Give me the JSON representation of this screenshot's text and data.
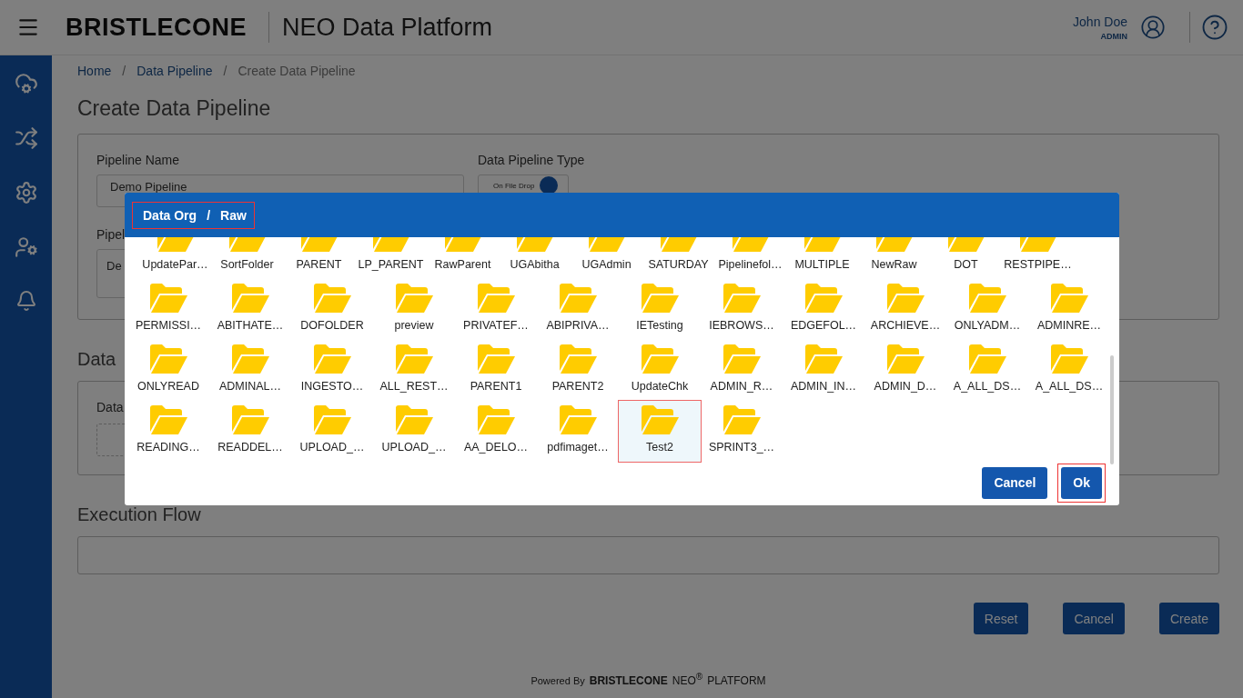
{
  "header": {
    "logo": "BRISTLECONE",
    "app_title": "NEO Data Platform",
    "user_name": "John Doe",
    "user_role": "ADMIN"
  },
  "breadcrumb_separator": "/",
  "breadcrumb": [
    {
      "label": "Home",
      "link": true
    },
    {
      "label": "Data Pipeline",
      "link": true
    },
    {
      "label": "Create Data Pipeline",
      "link": false
    }
  ],
  "page_title": "Create Data Pipeline",
  "form": {
    "pipeline_name_label": "Pipeline Name",
    "pipeline_name_value": "Demo Pipeline",
    "type_label": "Data Pipeline Type",
    "type_toggle": {
      "label": "On File Drop",
      "on": true
    },
    "description_label": "Pipel",
    "description_value": "De"
  },
  "data_section": {
    "title": "Data",
    "field_label": "Data"
  },
  "execution_flow": {
    "title": "Execution Flow"
  },
  "actions": [
    "Reset",
    "Cancel",
    "Create"
  ],
  "footer": {
    "powered_by": "Powered By",
    "brand": "BRISTLECONE",
    "product": "NEO$^{®}$",
    "suffix": "PLATFORM"
  },
  "dialog": {
    "path_separator": "/",
    "path": [
      {
        "label": "Data Org"
      },
      {
        "label": "Raw"
      }
    ],
    "folder_rows": [
      [
        {
          "name": "UpdatePar…",
          "selected": false
        },
        {
          "name": "SortFolder",
          "selected": false
        },
        {
          "name": "PARENT",
          "selected": false
        },
        {
          "name": "LP_PARENT",
          "selected": false
        },
        {
          "name": "RawParent",
          "selected": false
        },
        {
          "name": "UGAbitha",
          "selected": false
        },
        {
          "name": "UGAdmin",
          "selected": false
        },
        {
          "name": "SATURDAY",
          "selected": false
        },
        {
          "name": "Pipelinefol…",
          "selected": false
        },
        {
          "name": "MULTIPLE",
          "selected": false
        },
        {
          "name": "NewRaw",
          "selected": false
        },
        {
          "name": "DOT",
          "selected": false
        },
        {
          "name": "RESTPIPE…",
          "selected": false
        }
      ],
      [
        {
          "name": "PERMISSI…",
          "selected": false
        },
        {
          "name": "ABITHATE…",
          "selected": false
        },
        {
          "name": "DOFOLDER",
          "selected": false
        },
        {
          "name": "preview",
          "selected": false
        },
        {
          "name": "PRIVATEF…",
          "selected": false
        },
        {
          "name": "ABIPRIVA…",
          "selected": false
        },
        {
          "name": "IETesting",
          "selected": false
        },
        {
          "name": "IEBROWS…",
          "selected": false
        },
        {
          "name": "EDGEFOL…",
          "selected": false
        },
        {
          "name": "ARCHIEVE…",
          "selected": false
        },
        {
          "name": "ONLYADM…",
          "selected": false
        },
        {
          "name": "ADMINRE…",
          "selected": false
        }
      ],
      [
        {
          "name": "ONLYREAD",
          "selected": false
        },
        {
          "name": "ADMINAL…",
          "selected": false
        },
        {
          "name": "INGESTO…",
          "selected": false
        },
        {
          "name": "ALL_REST…",
          "selected": false
        },
        {
          "name": "PARENT1",
          "selected": false
        },
        {
          "name": "PARENT2",
          "selected": false
        },
        {
          "name": "UpdateChk",
          "selected": false
        },
        {
          "name": "ADMIN_R…",
          "selected": false
        },
        {
          "name": "ADMIN_IN…",
          "selected": false
        },
        {
          "name": "ADMIN_D…",
          "selected": false
        },
        {
          "name": "A_ALL_DS…",
          "selected": false
        },
        {
          "name": "A_ALL_DS…",
          "selected": false
        }
      ],
      [
        {
          "name": "READING…",
          "selected": false
        },
        {
          "name": "READDEL…",
          "selected": false
        },
        {
          "name": "UPLOAD_…",
          "selected": false
        },
        {
          "name": "UPLOAD_…",
          "selected": false
        },
        {
          "name": "AA_DELO…",
          "selected": false
        },
        {
          "name": "pdfimaget…",
          "selected": false
        },
        {
          "name": "Test2",
          "selected": true
        },
        {
          "name": "SPRINT3_…",
          "selected": false
        }
      ]
    ],
    "buttons": [
      {
        "label": "Cancel",
        "highlighted": false
      },
      {
        "label": "Ok",
        "highlighted": true
      }
    ]
  }
}
